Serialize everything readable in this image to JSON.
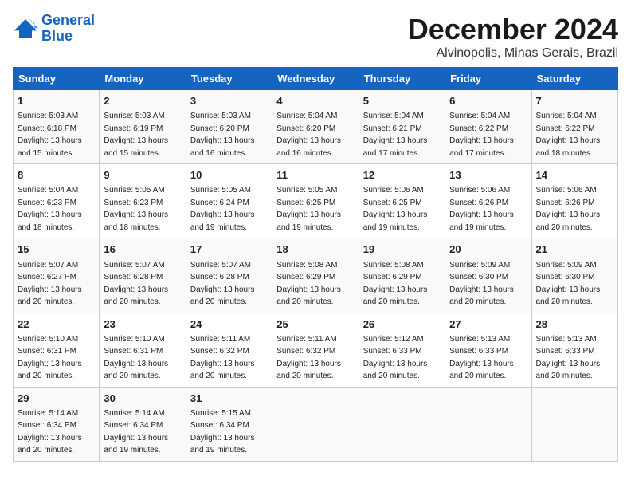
{
  "logo": {
    "line1": "General",
    "line2": "Blue"
  },
  "title": "December 2024",
  "subtitle": "Alvinopolis, Minas Gerais, Brazil",
  "days_of_week": [
    "Sunday",
    "Monday",
    "Tuesday",
    "Wednesday",
    "Thursday",
    "Friday",
    "Saturday"
  ],
  "weeks": [
    [
      {
        "day": "1",
        "sunrise": "Sunrise: 5:03 AM",
        "sunset": "Sunset: 6:18 PM",
        "daylight": "Daylight: 13 hours and 15 minutes."
      },
      {
        "day": "2",
        "sunrise": "Sunrise: 5:03 AM",
        "sunset": "Sunset: 6:19 PM",
        "daylight": "Daylight: 13 hours and 15 minutes."
      },
      {
        "day": "3",
        "sunrise": "Sunrise: 5:03 AM",
        "sunset": "Sunset: 6:20 PM",
        "daylight": "Daylight: 13 hours and 16 minutes."
      },
      {
        "day": "4",
        "sunrise": "Sunrise: 5:04 AM",
        "sunset": "Sunset: 6:20 PM",
        "daylight": "Daylight: 13 hours and 16 minutes."
      },
      {
        "day": "5",
        "sunrise": "Sunrise: 5:04 AM",
        "sunset": "Sunset: 6:21 PM",
        "daylight": "Daylight: 13 hours and 17 minutes."
      },
      {
        "day": "6",
        "sunrise": "Sunrise: 5:04 AM",
        "sunset": "Sunset: 6:22 PM",
        "daylight": "Daylight: 13 hours and 17 minutes."
      },
      {
        "day": "7",
        "sunrise": "Sunrise: 5:04 AM",
        "sunset": "Sunset: 6:22 PM",
        "daylight": "Daylight: 13 hours and 18 minutes."
      }
    ],
    [
      {
        "day": "8",
        "sunrise": "Sunrise: 5:04 AM",
        "sunset": "Sunset: 6:23 PM",
        "daylight": "Daylight: 13 hours and 18 minutes."
      },
      {
        "day": "9",
        "sunrise": "Sunrise: 5:05 AM",
        "sunset": "Sunset: 6:23 PM",
        "daylight": "Daylight: 13 hours and 18 minutes."
      },
      {
        "day": "10",
        "sunrise": "Sunrise: 5:05 AM",
        "sunset": "Sunset: 6:24 PM",
        "daylight": "Daylight: 13 hours and 19 minutes."
      },
      {
        "day": "11",
        "sunrise": "Sunrise: 5:05 AM",
        "sunset": "Sunset: 6:25 PM",
        "daylight": "Daylight: 13 hours and 19 minutes."
      },
      {
        "day": "12",
        "sunrise": "Sunrise: 5:06 AM",
        "sunset": "Sunset: 6:25 PM",
        "daylight": "Daylight: 13 hours and 19 minutes."
      },
      {
        "day": "13",
        "sunrise": "Sunrise: 5:06 AM",
        "sunset": "Sunset: 6:26 PM",
        "daylight": "Daylight: 13 hours and 19 minutes."
      },
      {
        "day": "14",
        "sunrise": "Sunrise: 5:06 AM",
        "sunset": "Sunset: 6:26 PM",
        "daylight": "Daylight: 13 hours and 20 minutes."
      }
    ],
    [
      {
        "day": "15",
        "sunrise": "Sunrise: 5:07 AM",
        "sunset": "Sunset: 6:27 PM",
        "daylight": "Daylight: 13 hours and 20 minutes."
      },
      {
        "day": "16",
        "sunrise": "Sunrise: 5:07 AM",
        "sunset": "Sunset: 6:28 PM",
        "daylight": "Daylight: 13 hours and 20 minutes."
      },
      {
        "day": "17",
        "sunrise": "Sunrise: 5:07 AM",
        "sunset": "Sunset: 6:28 PM",
        "daylight": "Daylight: 13 hours and 20 minutes."
      },
      {
        "day": "18",
        "sunrise": "Sunrise: 5:08 AM",
        "sunset": "Sunset: 6:29 PM",
        "daylight": "Daylight: 13 hours and 20 minutes."
      },
      {
        "day": "19",
        "sunrise": "Sunrise: 5:08 AM",
        "sunset": "Sunset: 6:29 PM",
        "daylight": "Daylight: 13 hours and 20 minutes."
      },
      {
        "day": "20",
        "sunrise": "Sunrise: 5:09 AM",
        "sunset": "Sunset: 6:30 PM",
        "daylight": "Daylight: 13 hours and 20 minutes."
      },
      {
        "day": "21",
        "sunrise": "Sunrise: 5:09 AM",
        "sunset": "Sunset: 6:30 PM",
        "daylight": "Daylight: 13 hours and 20 minutes."
      }
    ],
    [
      {
        "day": "22",
        "sunrise": "Sunrise: 5:10 AM",
        "sunset": "Sunset: 6:31 PM",
        "daylight": "Daylight: 13 hours and 20 minutes."
      },
      {
        "day": "23",
        "sunrise": "Sunrise: 5:10 AM",
        "sunset": "Sunset: 6:31 PM",
        "daylight": "Daylight: 13 hours and 20 minutes."
      },
      {
        "day": "24",
        "sunrise": "Sunrise: 5:11 AM",
        "sunset": "Sunset: 6:32 PM",
        "daylight": "Daylight: 13 hours and 20 minutes."
      },
      {
        "day": "25",
        "sunrise": "Sunrise: 5:11 AM",
        "sunset": "Sunset: 6:32 PM",
        "daylight": "Daylight: 13 hours and 20 minutes."
      },
      {
        "day": "26",
        "sunrise": "Sunrise: 5:12 AM",
        "sunset": "Sunset: 6:33 PM",
        "daylight": "Daylight: 13 hours and 20 minutes."
      },
      {
        "day": "27",
        "sunrise": "Sunrise: 5:13 AM",
        "sunset": "Sunset: 6:33 PM",
        "daylight": "Daylight: 13 hours and 20 minutes."
      },
      {
        "day": "28",
        "sunrise": "Sunrise: 5:13 AM",
        "sunset": "Sunset: 6:33 PM",
        "daylight": "Daylight: 13 hours and 20 minutes."
      }
    ],
    [
      {
        "day": "29",
        "sunrise": "Sunrise: 5:14 AM",
        "sunset": "Sunset: 6:34 PM",
        "daylight": "Daylight: 13 hours and 20 minutes."
      },
      {
        "day": "30",
        "sunrise": "Sunrise: 5:14 AM",
        "sunset": "Sunset: 6:34 PM",
        "daylight": "Daylight: 13 hours and 19 minutes."
      },
      {
        "day": "31",
        "sunrise": "Sunrise: 5:15 AM",
        "sunset": "Sunset: 6:34 PM",
        "daylight": "Daylight: 13 hours and 19 minutes."
      },
      null,
      null,
      null,
      null
    ]
  ]
}
